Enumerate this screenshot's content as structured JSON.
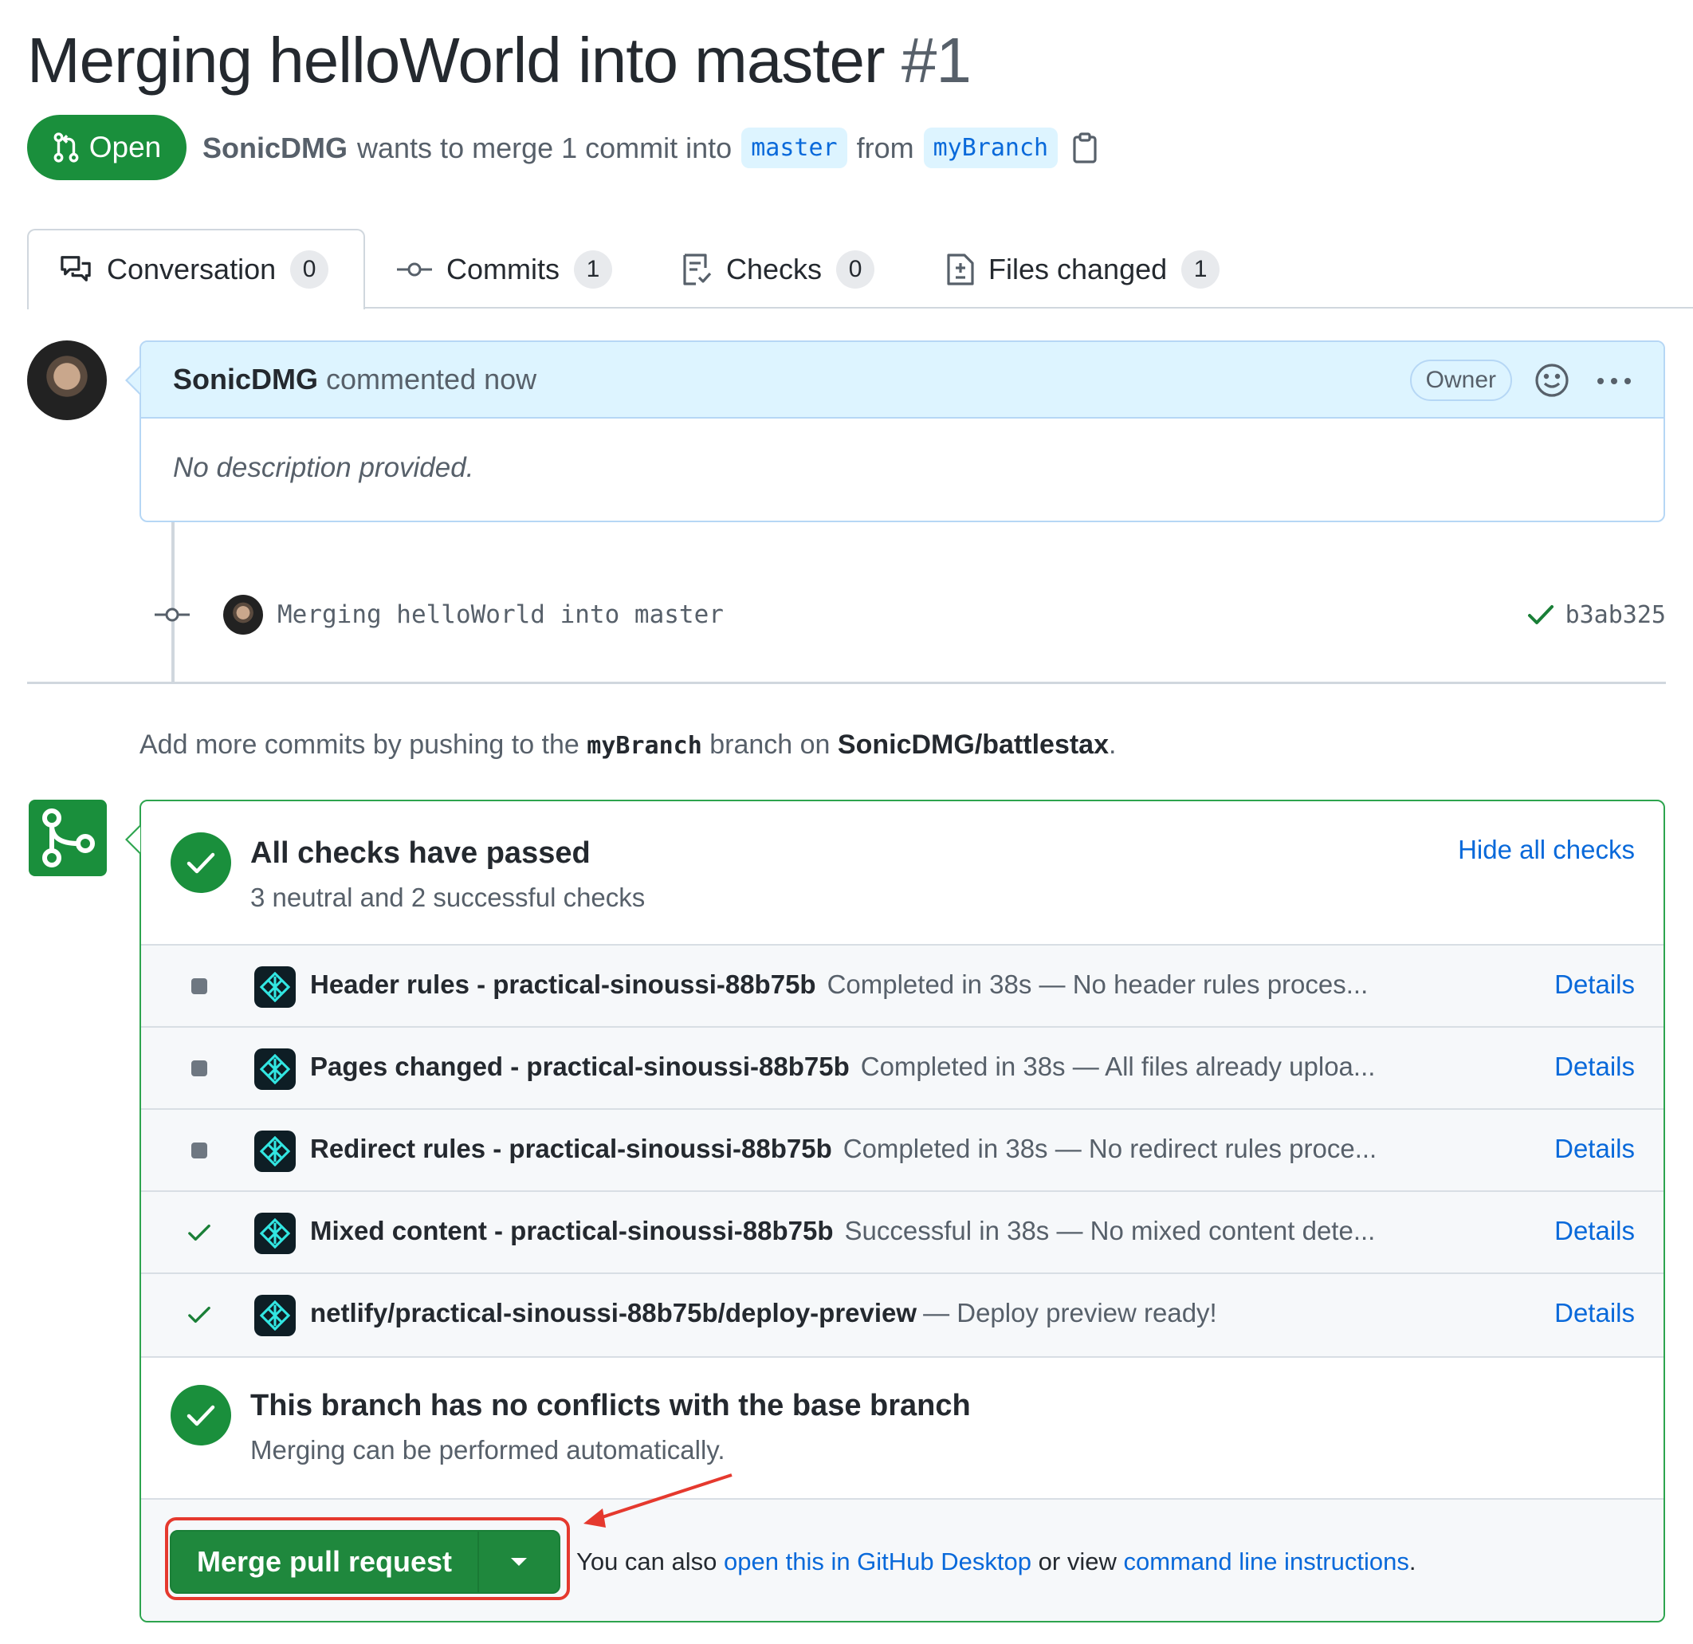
{
  "pr": {
    "title": "Merging helloWorld into master",
    "number": "#1",
    "state": "Open",
    "author": "SonicDMG",
    "meta_text": "wants to merge 1 commit into",
    "base_branch": "master",
    "from_text": "from",
    "head_branch": "myBranch"
  },
  "tabs": [
    {
      "label": "Conversation",
      "count": "0"
    },
    {
      "label": "Commits",
      "count": "1"
    },
    {
      "label": "Checks",
      "count": "0"
    },
    {
      "label": "Files changed",
      "count": "1"
    }
  ],
  "comment": {
    "author": "SonicDMG",
    "action": "commented now",
    "role": "Owner",
    "body": "No description provided."
  },
  "commit": {
    "message": "Merging helloWorld into master",
    "sha": "b3ab325"
  },
  "add_commits": {
    "prefix": "Add more commits by pushing to the",
    "branch": "myBranch",
    "middle": "branch on",
    "repo": "SonicDMG/battlestax",
    "suffix": "."
  },
  "checks": {
    "title": "All checks have passed",
    "subtitle": "3 neutral and 2 successful checks",
    "toggle_label": "Hide all checks",
    "details_label": "Details",
    "items": [
      {
        "name": "Header rules - practical-sinoussi-88b75b",
        "desc": "Completed in 38s — No header rules proces...",
        "status": "neutral"
      },
      {
        "name": "Pages changed - practical-sinoussi-88b75b",
        "desc": "Completed in 38s — All files already uploa...",
        "status": "neutral"
      },
      {
        "name": "Redirect rules - practical-sinoussi-88b75b",
        "desc": "Completed in 38s — No redirect rules proce...",
        "status": "neutral"
      },
      {
        "name": "Mixed content - practical-sinoussi-88b75b",
        "desc": "Successful in 38s — No mixed content dete...",
        "status": "success"
      },
      {
        "name": "netlify/practical-sinoussi-88b75b/deploy-preview",
        "desc": "— Deploy preview ready!",
        "status": "success"
      }
    ]
  },
  "conflicts": {
    "title": "This branch has no conflicts with the base branch",
    "subtitle": "Merging can be performed automatically."
  },
  "merge": {
    "button_label": "Merge pull request",
    "footer_prefix": "You can also",
    "desktop_link": "open this in GitHub Desktop",
    "footer_middle": "or view",
    "cli_link": "command line instructions",
    "footer_suffix": "."
  },
  "colors": {
    "green": "#1a8f3c",
    "link_blue": "#0969da",
    "annotation_red": "#e5392e"
  }
}
